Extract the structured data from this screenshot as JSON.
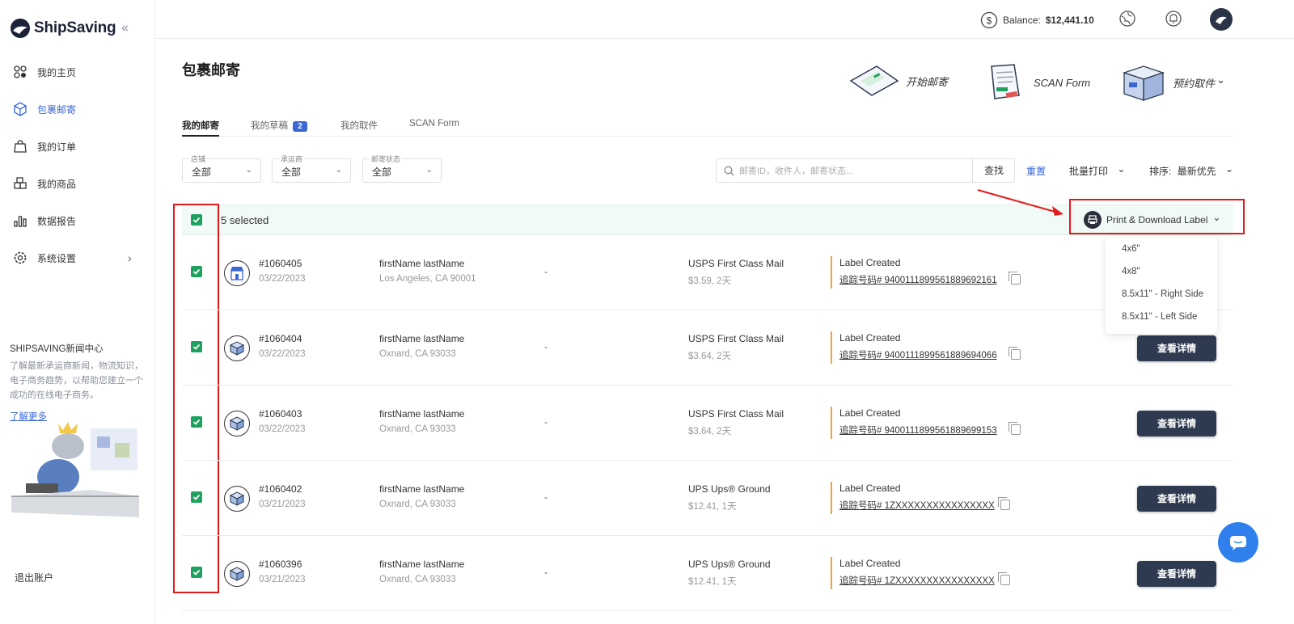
{
  "app": {
    "logo_text": "ShipSaving",
    "collapse_icon": "«"
  },
  "sidebar": {
    "items": [
      {
        "label": "我的主页",
        "icon": "home-icon"
      },
      {
        "label": "包裹邮寄",
        "icon": "package-icon",
        "active": true
      },
      {
        "label": "我的订单",
        "icon": "bag-icon"
      },
      {
        "label": "我的商品",
        "icon": "products-icon"
      },
      {
        "label": "数据报告",
        "icon": "chart-icon"
      },
      {
        "label": "系统设置",
        "icon": "gear-icon",
        "arrow": "›"
      }
    ],
    "news_title": "SHIPSAVING新闻中心",
    "news_text": "了解最新承运商新闻，物流知识，电子商务趋势，以帮助您建立一个成功的在线电子商务。",
    "news_link": "了解更多",
    "logout": "退出账户"
  },
  "topbar": {
    "balance_label": "Balance:",
    "balance_value": "$12,441.10"
  },
  "page": {
    "title": "包裹邮寄",
    "actions": {
      "start": "开始邮寄",
      "scan": "SCAN Form",
      "pickup": "预约取件",
      "pickup_chevron": "⌄"
    }
  },
  "tabs": [
    {
      "label": "我的邮寄",
      "active": true
    },
    {
      "label": "我的草稿",
      "badge": "2"
    },
    {
      "label": "我的取件"
    },
    {
      "label": "SCAN Form"
    }
  ],
  "filters": [
    {
      "label": "店铺",
      "value": "全部"
    },
    {
      "label": "承运商",
      "value": "全部"
    },
    {
      "label": "邮寄状态",
      "value": "全部"
    }
  ],
  "search": {
    "placeholder": "邮寄ID，收件人，邮寄状态...",
    "button": "查找"
  },
  "toolbar": {
    "reset": "重置",
    "bulk_print": "批量打印",
    "sort_label": "排序:",
    "sort_value": "最新优先",
    "chevron": "⌄"
  },
  "selection": {
    "text": "5 selected",
    "print_button": "Print & Download Label"
  },
  "dropdown": {
    "options": [
      "4x6\"",
      "4x8\"",
      "8.5x11\" - Right Side",
      "8.5x11\" - Left Side"
    ]
  },
  "rows": [
    {
      "id": "#1060405",
      "date": "03/22/2023",
      "name": "firstName lastName",
      "addr": "Los Angeles, CA 90001",
      "dash": "-",
      "service": "USPS First Class Mail",
      "price": "$3.59, 2天",
      "status": "Label Created",
      "tracking": "追踪号码# 9400111899561889692161",
      "icon": "store-icon"
    },
    {
      "id": "#1060404",
      "date": "03/22/2023",
      "name": "firstName lastName",
      "addr": "Oxnard, CA 93033",
      "dash": "-",
      "service": "USPS First Class Mail",
      "price": "$3.64, 2天",
      "status": "Label Created",
      "tracking": "追踪号码# 9400111899561889694066",
      "detail": "查看详情",
      "icon": "box-icon"
    },
    {
      "id": "#1060403",
      "date": "03/22/2023",
      "name": "firstName lastName",
      "addr": "Oxnard, CA 93033",
      "dash": "-",
      "service": "USPS First Class Mail",
      "price": "$3.64, 2天",
      "status": "Label Created",
      "tracking": "追踪号码# 9400111899561889699153",
      "detail": "查看详情",
      "icon": "box-icon"
    },
    {
      "id": "#1060402",
      "date": "03/21/2023",
      "name": "firstName lastName",
      "addr": "Oxnard, CA 93033",
      "dash": "-",
      "service": "UPS Ups® Ground",
      "price": "$12.41, 1天",
      "status": "Label Created",
      "tracking": "追踪号码# 1ZXXXXXXXXXXXXXXXX",
      "detail": "查看详情",
      "icon": "box-icon"
    },
    {
      "id": "#1060396",
      "date": "03/21/2023",
      "name": "firstName lastName",
      "addr": "Oxnard, CA 93033",
      "dash": "-",
      "service": "UPS Ups® Ground",
      "price": "$12.41, 1天",
      "status": "Label Created",
      "tracking": "追踪号码# 1ZXXXXXXXXXXXXXXXX",
      "detail": "查看详情",
      "icon": "box-icon"
    }
  ],
  "colors": {
    "accent": "#3a66d6",
    "checkbox": "#1fa15f",
    "detail_button": "#2e3a4f",
    "highlight": "#e11b1b",
    "status_line": "#f2a23a"
  }
}
